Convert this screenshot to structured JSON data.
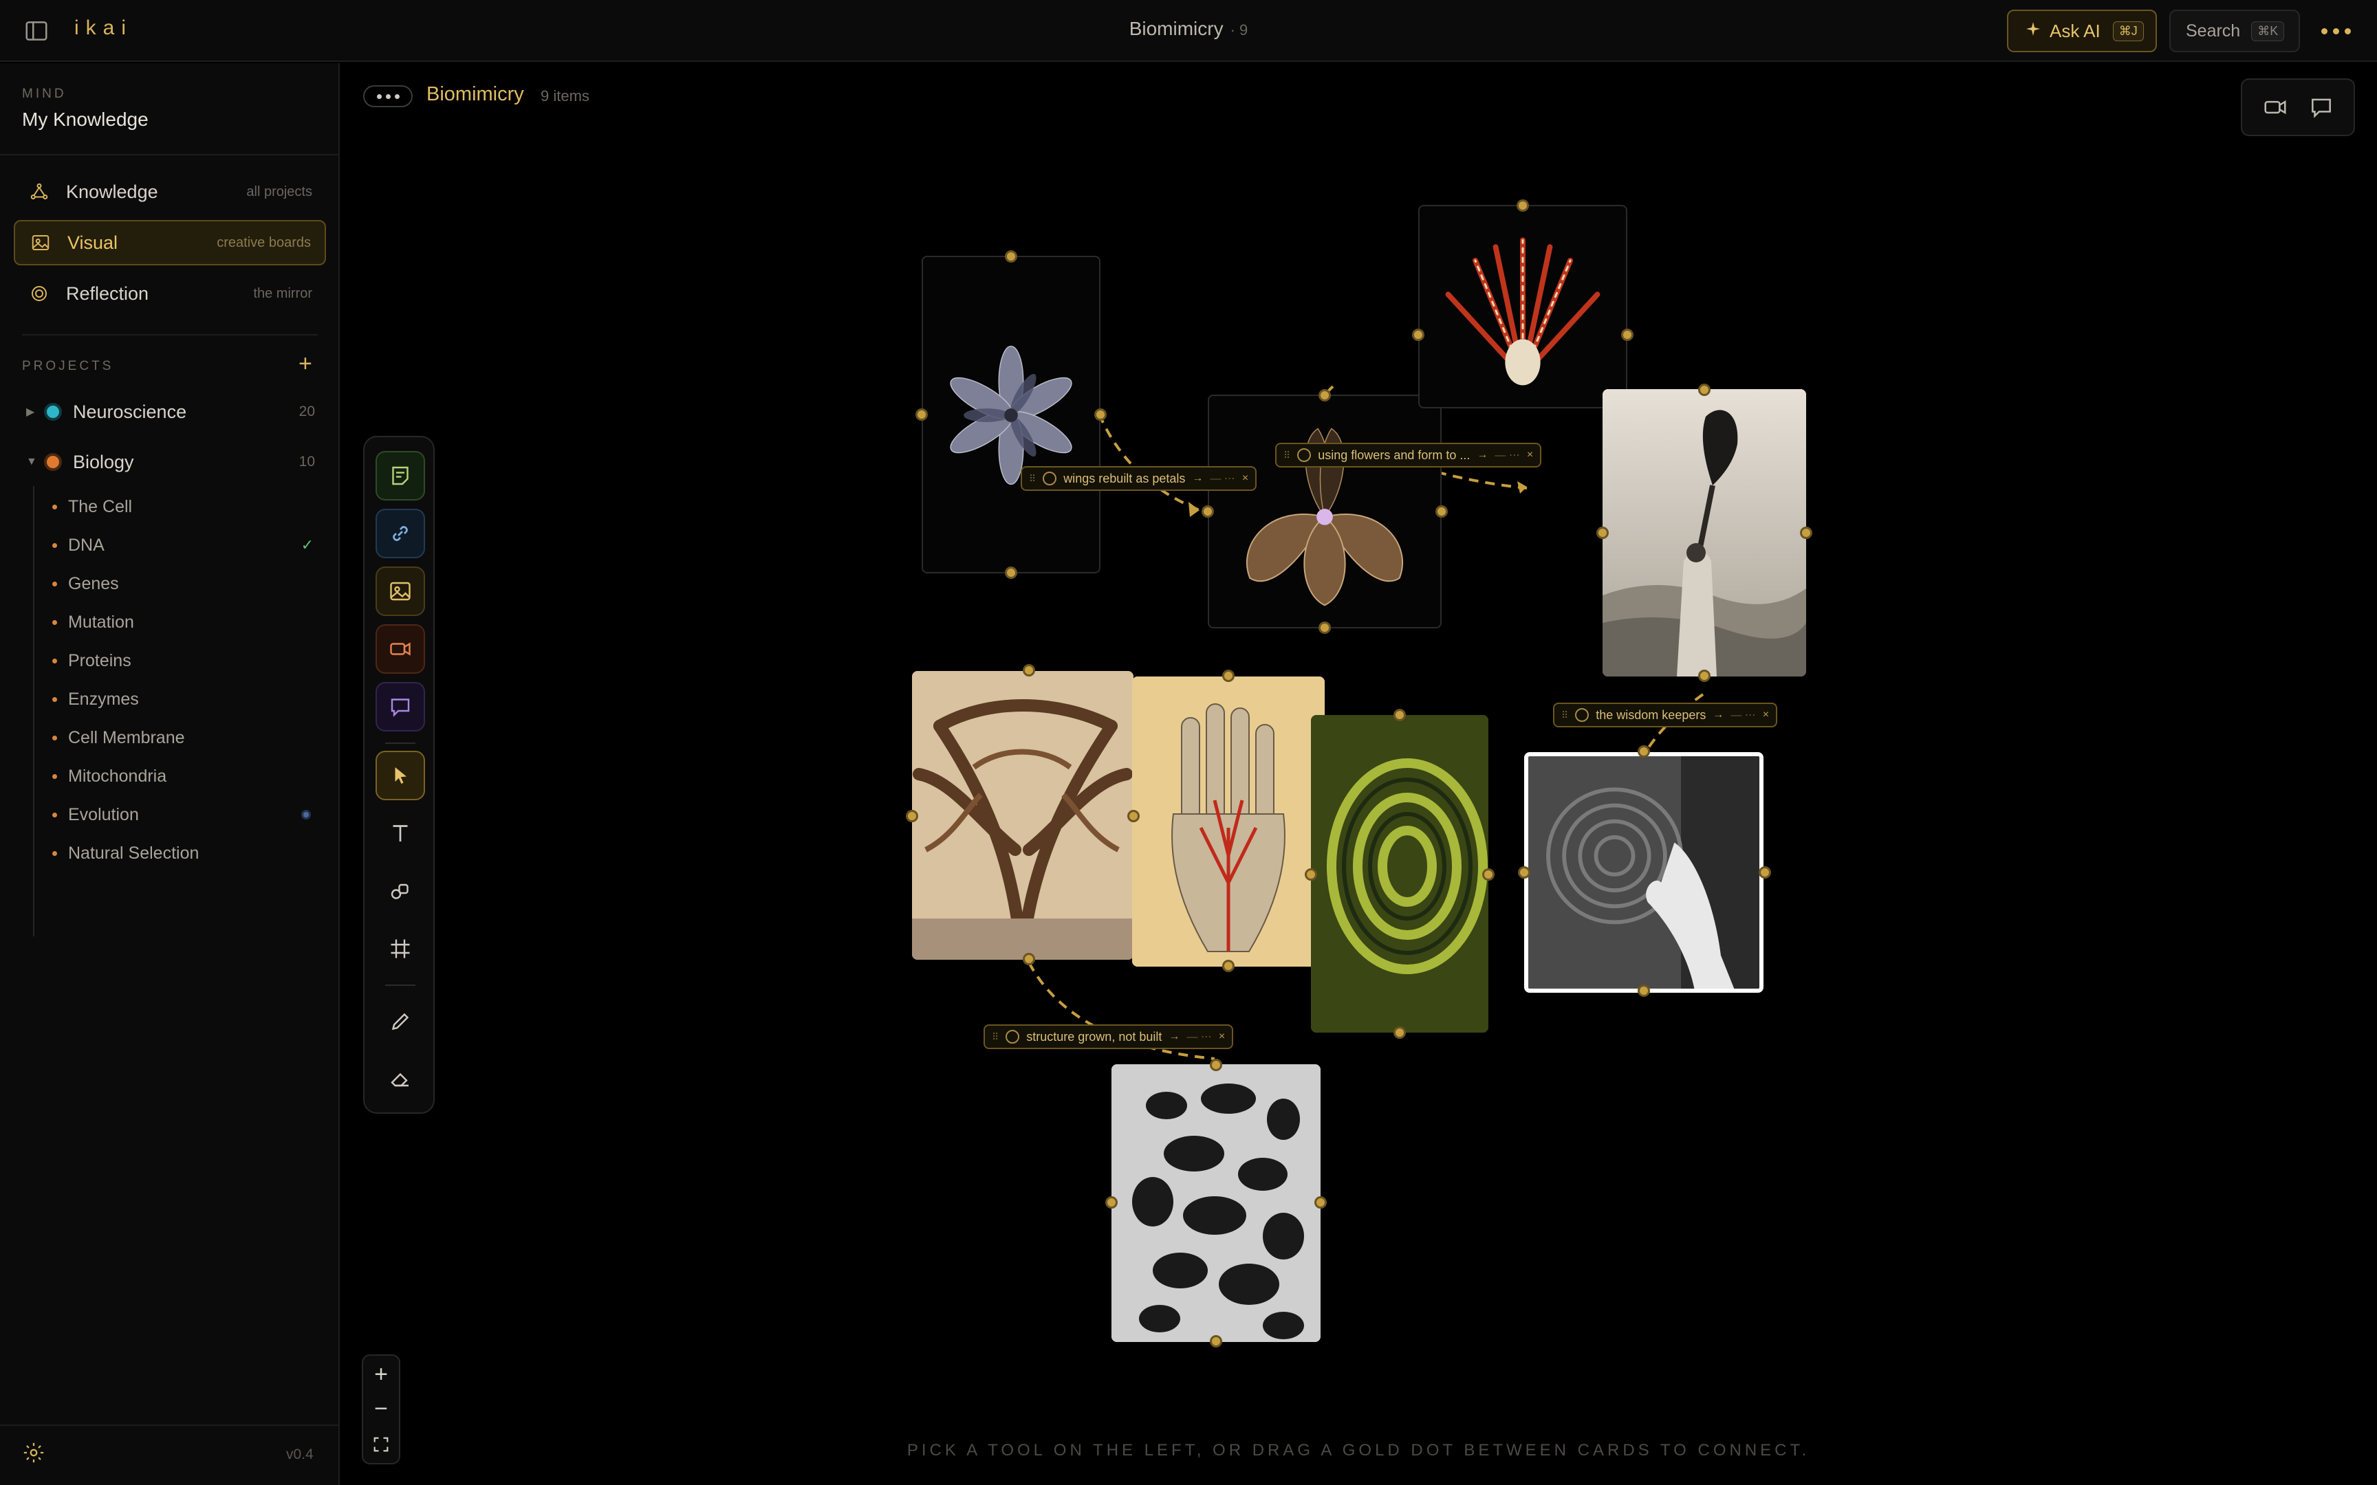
{
  "app": {
    "logo": "ikai",
    "title": "Biomimicry",
    "title_count": "· 9"
  },
  "topbar": {
    "ask_ai_label": "Ask AI",
    "ask_ai_kbd": "⌘J",
    "search_label": "Search",
    "search_kbd": "⌘K"
  },
  "sidebar": {
    "mind_label": "MIND",
    "mind_name": "My Knowledge",
    "nav": [
      {
        "label": "Knowledge",
        "sub": "all projects"
      },
      {
        "label": "Visual",
        "sub": "creative boards"
      },
      {
        "label": "Reflection",
        "sub": "the mirror"
      }
    ],
    "projects_label": "PROJECTS",
    "add_project": "+",
    "projects": [
      {
        "name": "Neuroscience",
        "count": "20",
        "caret": "▶",
        "color": "#2fb6c8"
      },
      {
        "name": "Biology",
        "count": "10",
        "caret": "▼",
        "color": "#e07a2e"
      }
    ],
    "biology_items": [
      {
        "name": "The Cell"
      },
      {
        "name": "DNA",
        "mark": "✓"
      },
      {
        "name": "Genes"
      },
      {
        "name": "Mutation"
      },
      {
        "name": "Proteins"
      },
      {
        "name": "Enzymes"
      },
      {
        "name": "Cell Membrane"
      },
      {
        "name": "Mitochondria"
      },
      {
        "name": "Evolution"
      },
      {
        "name": "Natural Selection"
      }
    ],
    "version": "v0.4"
  },
  "board": {
    "title": "Biomimicry",
    "count": "9 items",
    "hint": "PICK A TOOL ON THE LEFT, OR DRAG A GOLD DOT BETWEEN CARDS TO CONNECT."
  },
  "connections": [
    {
      "label": "wings rebuilt as petals"
    },
    {
      "label": "using flowers and form to ..."
    },
    {
      "label": "the wisdom keepers"
    },
    {
      "label": "structure grown, not built"
    }
  ],
  "zoom": {
    "in": "+",
    "out": "−"
  },
  "colors": {
    "accent": "#d9b45a",
    "background": "#000000",
    "panel": "#0b0b0b"
  }
}
